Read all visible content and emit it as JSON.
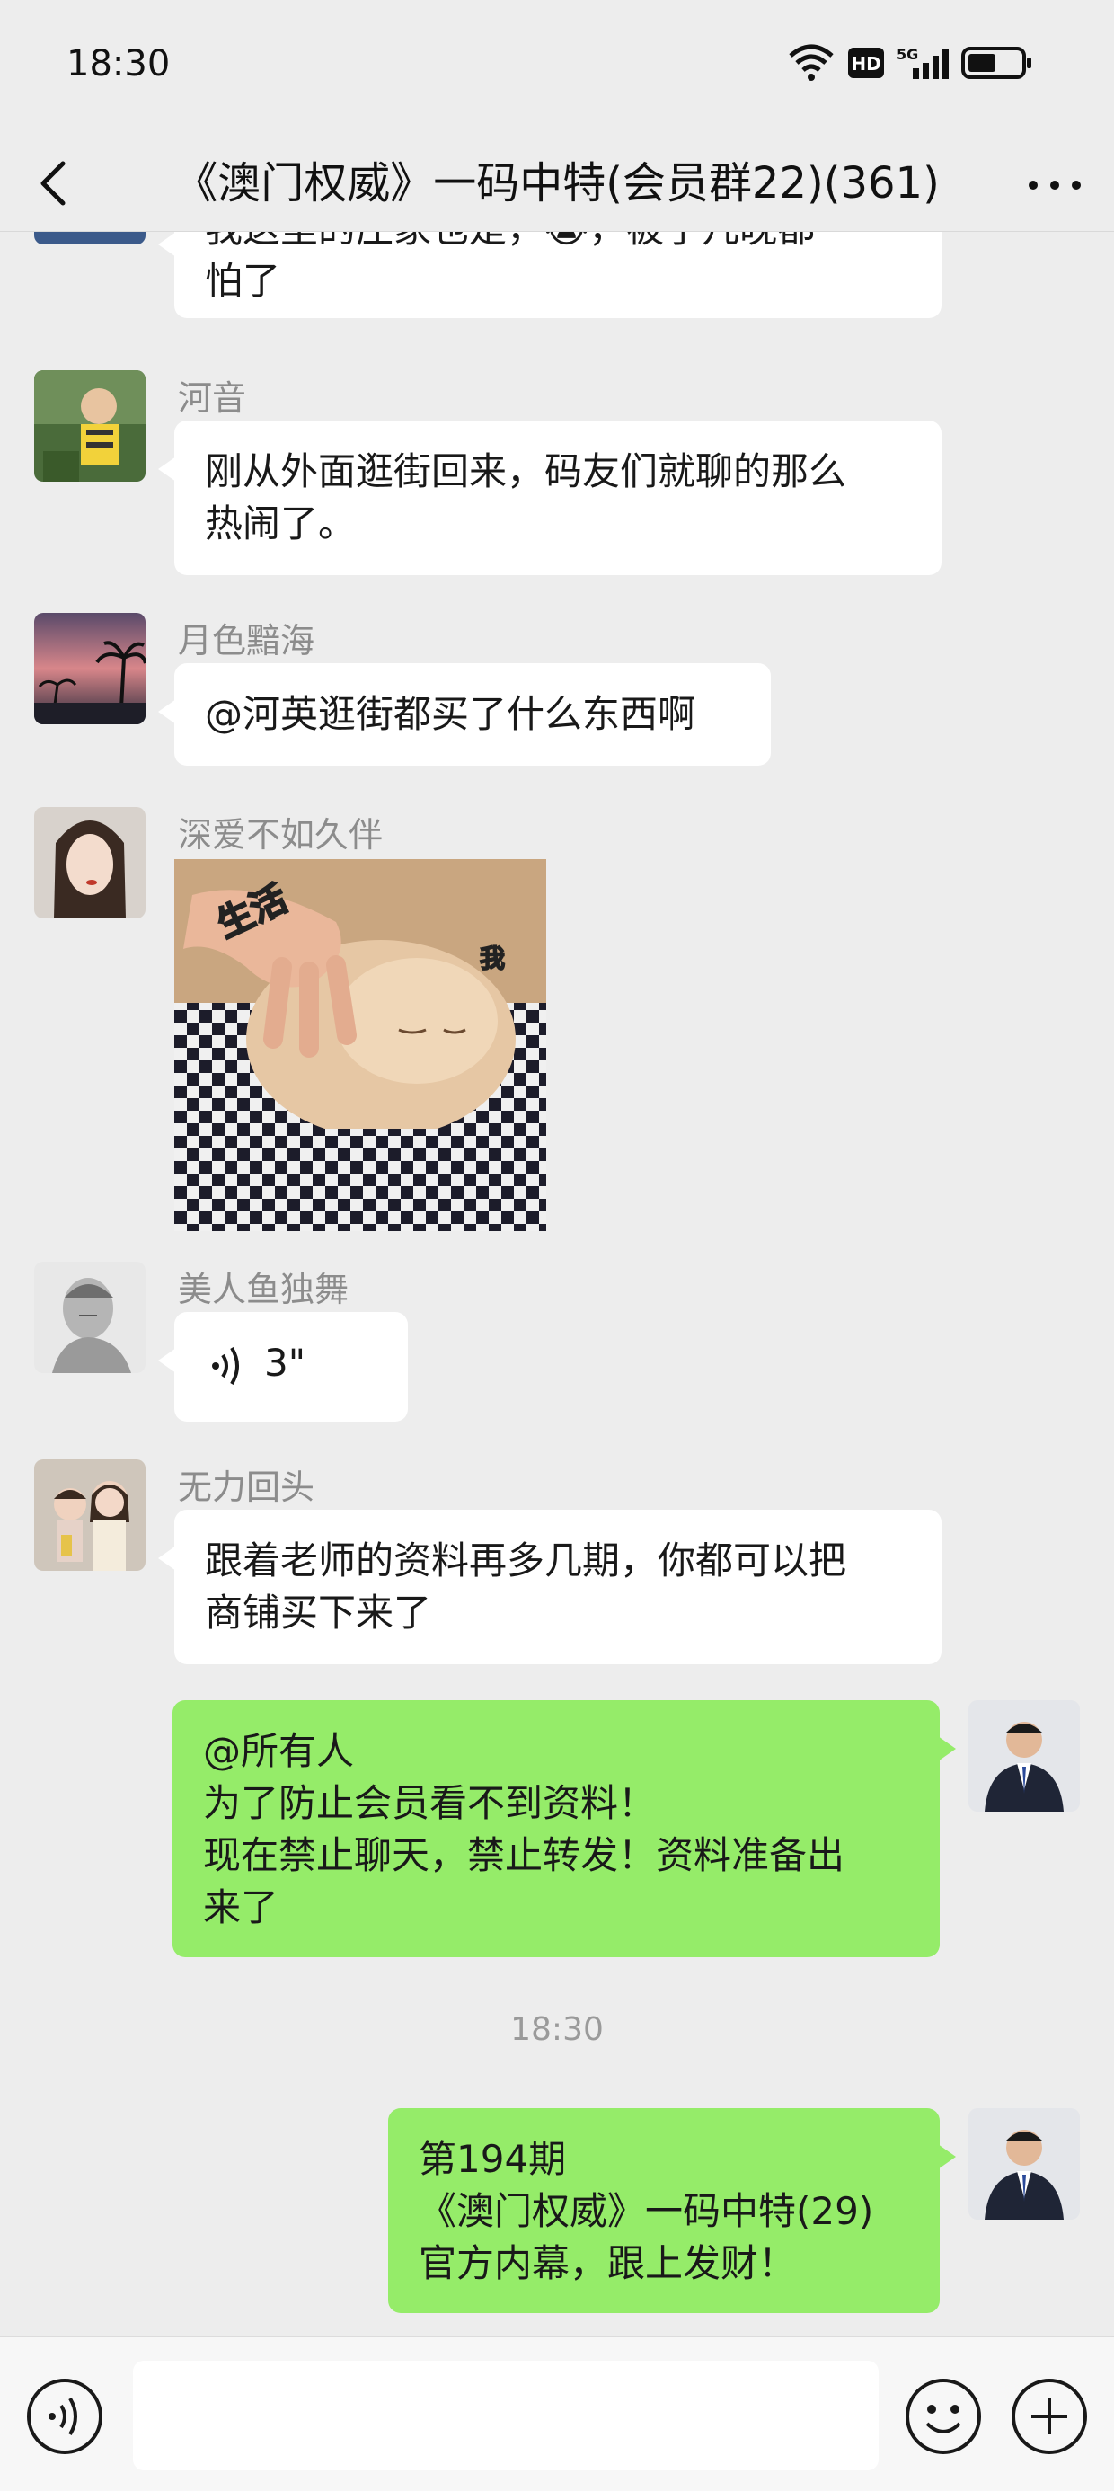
{
  "status_bar": {
    "time": "18:30",
    "badges": [
      "HD",
      "5G"
    ]
  },
  "header": {
    "title": "《澳门权威》一码中特(会员群22)(361)",
    "back_icon": "chevron-left-icon",
    "more_icon": "more-dots-icon"
  },
  "messages": [
    {
      "sender": "",
      "lines": [
        "我这里的庄家也是，😭，被了几晚都",
        "怕了"
      ],
      "side": "left"
    },
    {
      "sender": "河音",
      "lines": [
        "刚从外面逛街回来，码友们就聊的那么",
        "热闹了。"
      ],
      "side": "left"
    },
    {
      "sender": "月色黯海",
      "lines": [
        "@河英逛街都买了什么东西啊"
      ],
      "side": "left"
    },
    {
      "sender": "深爱不如久伴",
      "image_labels": [
        "生活",
        "我"
      ],
      "side": "left"
    },
    {
      "sender": "美人鱼独舞",
      "voice_duration": "3\"",
      "side": "left"
    },
    {
      "sender": "无力回头",
      "lines": [
        "跟着老师的资料再多几期，你都可以把",
        "商铺买下来了"
      ],
      "side": "left"
    },
    {
      "lines": [
        "@所有人",
        "为了防止会员看不到资料！",
        "现在禁止聊天，禁止转发！资料准备出",
        "来了"
      ],
      "side": "right"
    },
    {
      "lines": [
        "第194期",
        "《澳门权威》一码中特(29)",
        "官方内幕，跟上发财！"
      ],
      "side": "right"
    }
  ],
  "timestamp": "18:30",
  "input": {
    "value": "",
    "placeholder": ""
  },
  "colors": {
    "background": "#ededed",
    "bubble_self": "#95ec69",
    "bubble_other": "#ffffff"
  }
}
